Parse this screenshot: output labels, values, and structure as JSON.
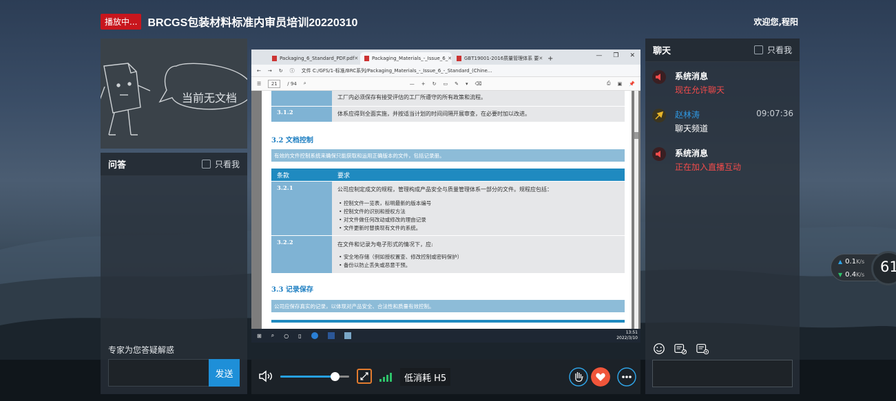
{
  "header": {
    "live_badge": "播放中...",
    "title": "BRCGS包装材料标准内审员培训20220310",
    "welcome": "欢迎您,程阳"
  },
  "doc_panel": {
    "empty_text": "当前无文档"
  },
  "qa": {
    "title": "问答",
    "only_me": "只看我",
    "hint": "专家为您答疑解惑",
    "send": "发送"
  },
  "shared_screen": {
    "tabs": [
      {
        "label": "Packaging_6_Standard_PDF.pdf",
        "active": false
      },
      {
        "label": "Packaging_Materials_-_Issue_6_",
        "active": true
      },
      {
        "label": "GBT19001-2016质量管理体系 要",
        "active": false
      }
    ],
    "address": "文件  C:/GFS/1-标准/BRC系列/Packaging_Materials_-_Issue_6_-_Standard_(Chine...",
    "page_current": "21",
    "page_total": "/ 94",
    "pdf": {
      "top_text": "工厂内必须保存有接受评估的工厂所遵守的所有政策和流程。",
      "c312_num": "3.1.2",
      "c312_text": "体系应得到全面实施，并按适当计划的时间间隔开展审查，在必要时加以改进。",
      "s32_title": "3.2    文档控制",
      "s32_strip": "有效的文件控制系统来确保只能获取和运用正确版本的文件，包括记录册。",
      "th_clause": "条款",
      "th_req": "要求",
      "c321_num": "3.2.1",
      "c321_text": "公司应制定成文的规程，管理构成产品安全与质量管理体系一部分的文件。规程应包括：",
      "c321_bullets": [
        "控制文件一览表，标明最新的版本编号",
        "控制文件的识别和授权方法",
        "对文件做任何改动或修改的理由记录",
        "文件更新时替换现有文件的系统。"
      ],
      "c322_num": "3.2.2",
      "c322_text": "在文件和记录为电子形式的情况下，应:",
      "c322_bullets": [
        "安全地存储（例如授权置查、修改控制或密码保护）",
        "备份以防止丢失或恶意干预。"
      ],
      "s33_title": "3.3    记录保存",
      "s33_strip": "公司应保存真实的记录，以体现对产品安全、合法性和质量有效控制。"
    },
    "taskbar_time": "13:51",
    "taskbar_date": "2022/3/10"
  },
  "player": {
    "quality": "低消耗 H5",
    "volume": 0.8
  },
  "chat": {
    "title": "聊天",
    "only_me": "只看我",
    "messages": [
      {
        "name": "系统消息",
        "text": "现在允许聊天",
        "time": ""
      },
      {
        "name": "赵林涛",
        "text": "聊天频道",
        "time": "09:07:36"
      },
      {
        "name": "系统消息",
        "text": "正在加入直播互动",
        "time": ""
      }
    ]
  },
  "net_speed": {
    "up": "0.1",
    "down": "0.4",
    "unit": "K/s",
    "score": "61"
  },
  "colors": {
    "accent_blue": "#1e8fd8",
    "live_red": "#c8161d",
    "system_red": "#f24b4b",
    "fullscreen_orange": "#e27b2e"
  }
}
